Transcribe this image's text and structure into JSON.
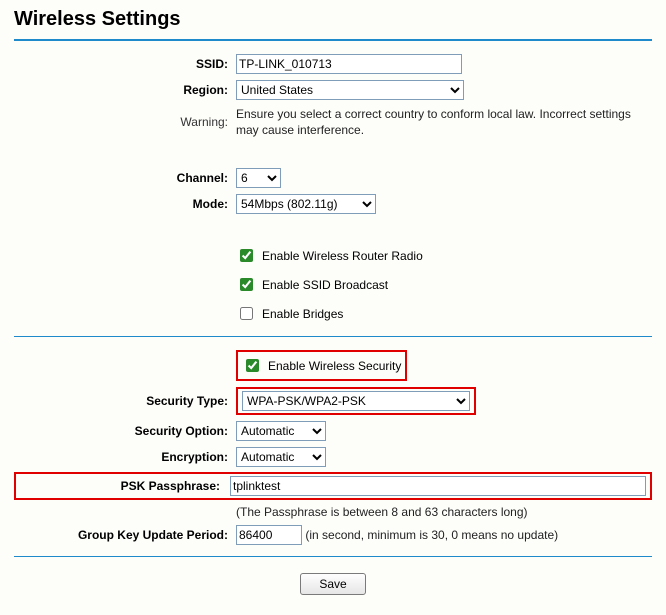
{
  "title": "Wireless Settings",
  "labels": {
    "ssid": "SSID:",
    "region": "Region:",
    "warning": "Warning:",
    "channel": "Channel:",
    "mode": "Mode:",
    "securityType": "Security Type:",
    "securityOption": "Security Option:",
    "encryption": "Encryption:",
    "pskPassphrase": "PSK Passphrase:",
    "groupKeyUpdate": "Group Key Update Period:"
  },
  "fields": {
    "ssid": "TP-LINK_010713",
    "region": "United States",
    "warningText": "Ensure you select a correct country to conform local law. Incorrect settings may cause interference.",
    "channel": "6",
    "mode": "54Mbps (802.11g)",
    "enableRadio": {
      "checked": true,
      "label": "Enable Wireless Router Radio"
    },
    "enableSSID": {
      "checked": true,
      "label": "Enable SSID Broadcast"
    },
    "enableBridges": {
      "checked": false,
      "label": "Enable Bridges"
    },
    "enableSecurity": {
      "checked": true,
      "label": "Enable Wireless Security"
    },
    "securityType": "WPA-PSK/WPA2-PSK",
    "securityOption": "Automatic",
    "encryption": "Automatic",
    "pskPassphrase": "tplinktest",
    "pskNote": "(The Passphrase is between 8 and 63 characters long)",
    "groupKeyUpdate": "86400",
    "groupKeyNote": "(in second, minimum is 30, 0 means no update)"
  },
  "buttons": {
    "save": "Save"
  }
}
